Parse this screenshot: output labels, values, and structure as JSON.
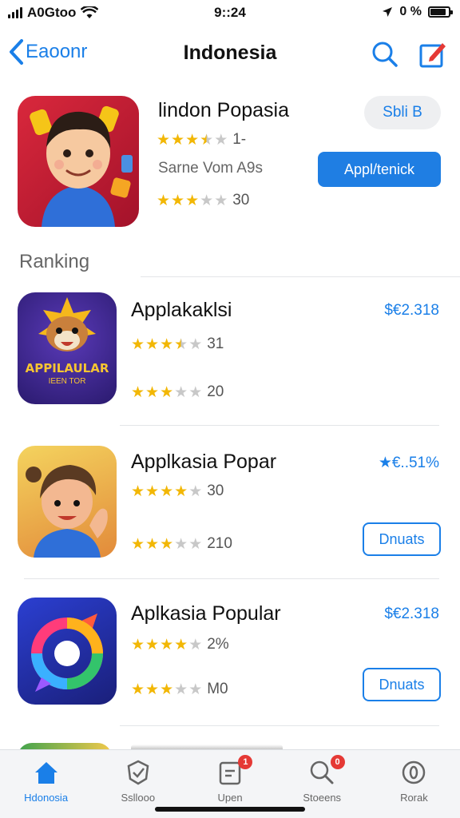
{
  "status_bar": {
    "carrier": "A0Gtoo",
    "time": "9::24",
    "battery": "0 %"
  },
  "nav": {
    "back_label": "Eaoonr",
    "title": "Indonesia",
    "icons": [
      "search-icon",
      "compose-icon"
    ]
  },
  "featured": {
    "title": "lindon Popasia",
    "rating_text": "1-",
    "stars_top": 3.5,
    "subtitle": "Sarne Vom A9s",
    "stars_bottom": 3,
    "rating_count": "30",
    "pill_button": "Sbli B",
    "primary_button": "Appl/tenick"
  },
  "section_title": "Ranking",
  "ranking": [
    {
      "title": "Applakaklsi",
      "price": "$€2.318",
      "stars_a": 3.5,
      "rating_a": "31",
      "stars_b": 3,
      "rating_b": "20",
      "icon_text_1": "APPILAULAR",
      "icon_text_2": "IEEN TOR"
    },
    {
      "title": "Applkasia Popar",
      "price": "★€..51%",
      "stars_a": 4,
      "rating_a": "30",
      "stars_b": 3,
      "rating_b": "210",
      "button": "Dnuats"
    },
    {
      "title": "Aplkasia Popular",
      "price": "$€2.318",
      "stars_a": 4,
      "rating_a": "2%",
      "stars_b": 3,
      "rating_b": "M0",
      "button": "Dnuats"
    }
  ],
  "tab_bar": {
    "tabs": [
      {
        "label": "Hdonosia",
        "icon": "home-icon",
        "badge": ""
      },
      {
        "label": "Ssllooo",
        "icon": "shield-check-icon",
        "badge": ""
      },
      {
        "label": "Upen",
        "icon": "updates-icon",
        "badge": "1"
      },
      {
        "label": "Stoeens",
        "icon": "search-icon",
        "badge": "0"
      },
      {
        "label": "Rorak",
        "icon": "account-icon",
        "badge": ""
      }
    ]
  },
  "colors": {
    "accent": "#1a7fe8",
    "star": "#f2b705",
    "badge": "#e53935"
  }
}
